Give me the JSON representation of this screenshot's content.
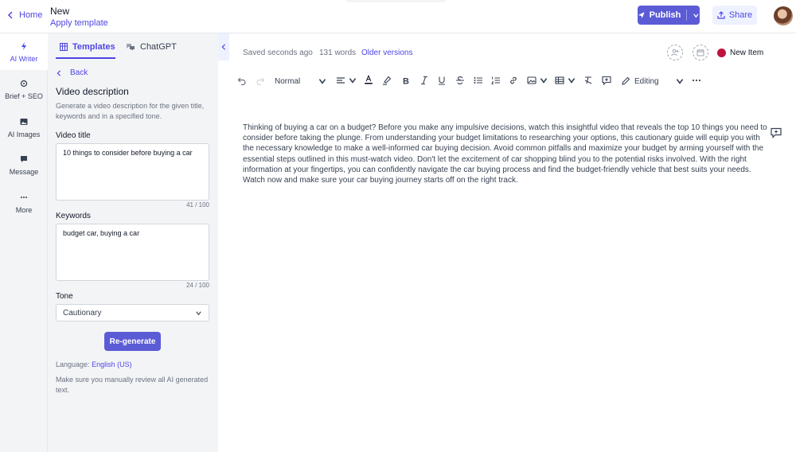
{
  "header": {
    "home_label": "Home",
    "doc_title": "New",
    "apply_template": "Apply template",
    "publish_label": "Publish",
    "share_label": "Share"
  },
  "rail": {
    "items": [
      {
        "label": "AI Writer",
        "icon": "bolt-icon"
      },
      {
        "label": "Brief + SEO",
        "icon": "target-icon"
      },
      {
        "label": "AI Images",
        "icon": "image-icon"
      },
      {
        "label": "Message",
        "icon": "message-icon"
      },
      {
        "label": "More",
        "icon": "more-icon"
      }
    ]
  },
  "panel": {
    "tabs": [
      {
        "label": "Templates",
        "icon": "grid-icon"
      },
      {
        "label": "ChatGPT",
        "icon": "chat-icon"
      }
    ],
    "back_label": "Back",
    "title": "Video description",
    "description": "Generate a video description for the given title, keywords and in a specified tone.",
    "video_title_label": "Video title",
    "video_title_value": "10 things to consider before buying a car",
    "video_title_counter": "41 / 100",
    "keywords_label": "Keywords",
    "keywords_value": "budget car, buying a car",
    "keywords_counter": "24 / 100",
    "tone_label": "Tone",
    "tone_value": "Cautionary",
    "regenerate_label": "Re-generate",
    "language_prefix": "Language:",
    "language_value": "English (US)",
    "review_note": "Make sure you manually review all AI generated text."
  },
  "editor": {
    "saved_status": "Saved seconds ago",
    "word_count": "131 words",
    "older_versions": "Older versions",
    "status_label": "New Item",
    "status_color": "#be123c",
    "toolbar": {
      "paragraph_style": "Normal",
      "mode": "Editing"
    },
    "body": "Thinking of buying a car on a budget? Before you make any impulsive decisions, watch this insightful video that reveals the top 10 things you need to consider before taking the plunge. From understanding your budget limitations to researching your options, this cautionary guide will equip you with the necessary knowledge to make a well-informed car buying decision. Avoid common pitfalls and maximize your budget by arming yourself with the essential steps outlined in this must-watch video. Don't let the excitement of car shopping blind you to the potential risks involved. With the right information at your fingertips, you can confidently navigate the car buying process and find the budget-friendly vehicle that best suits your needs. Watch now and make sure your car buying journey starts off on the right track."
  },
  "colors": {
    "accent": "#4f46e5",
    "button": "#5b5bd6",
    "panel_bg": "#f3f4f6"
  }
}
